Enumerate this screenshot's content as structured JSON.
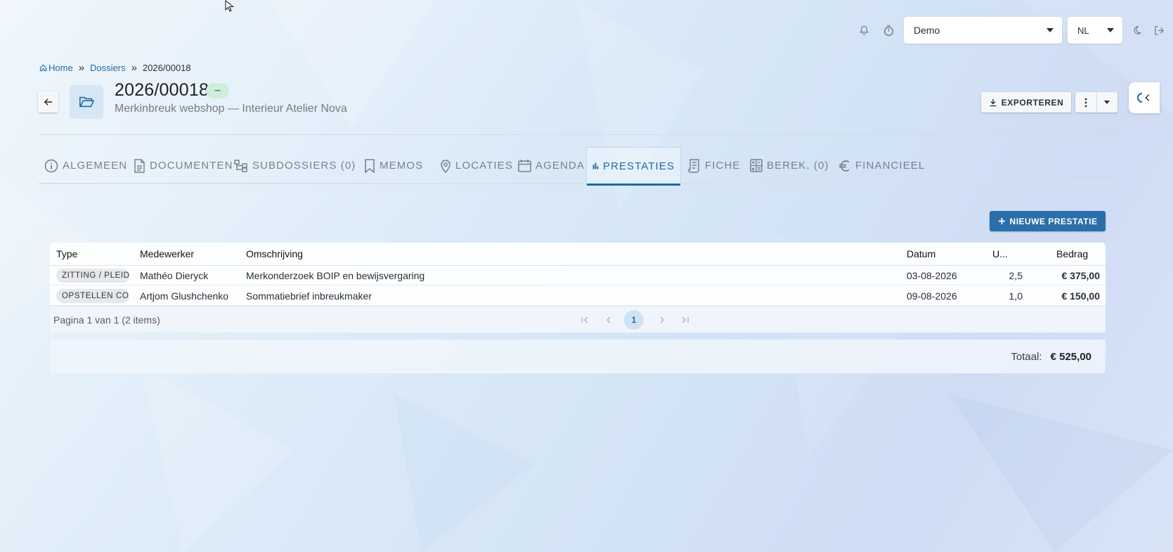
{
  "topbar": {
    "organisation": "Demo",
    "language": "NL"
  },
  "breadcrumb": {
    "home": "Home",
    "dossiers": "Dossiers",
    "current": "2026/00018"
  },
  "header": {
    "title": "2026/00018",
    "status": "–",
    "subtitle": "Merkinbreuk webshop — Interieur Atelier Nova",
    "export_label": "EXPORTEREN"
  },
  "tabs": [
    {
      "label": "ALGEMEEN",
      "icon": "info-icon"
    },
    {
      "label": "DOCUMENTEN",
      "icon": "document-icon"
    },
    {
      "label": "SUBDOSSIERS (0)",
      "icon": "tree-icon"
    },
    {
      "label": "MEMOS",
      "icon": "bookmark-icon"
    },
    {
      "label": "LOCATIES",
      "icon": "location-pin-icon"
    },
    {
      "label": "AGENDA",
      "icon": "calendar-icon"
    },
    {
      "label": "PRESTATIES",
      "icon": "bar-chart-icon",
      "active": true
    },
    {
      "label": "FICHE",
      "icon": "receipt-icon"
    },
    {
      "label": "BEREK. (0)",
      "icon": "calculator-icon"
    },
    {
      "label": "FINANCIEEL",
      "icon": "euro-icon"
    }
  ],
  "new_button": "NIEUWE PRESTATIE",
  "table": {
    "columns": [
      "Type",
      "Medewerker",
      "Omschrijving",
      "Datum",
      "U...",
      "Bedrag"
    ],
    "rows": [
      {
        "type": "ZITTING / PLEIDOOI",
        "employee": "Mathéo Dieryck",
        "description": "Merkonderzoek BOIP en bewijsvergaring",
        "date": "03-08-2026",
        "hours": "2,5",
        "amount": "€ 375,00"
      },
      {
        "type": "OPSTELLEN CONCLUSIE",
        "employee": "Artjom Glushchenko",
        "description": "Sommatiebrief inbreukmaker",
        "date": "09-08-2026",
        "hours": "1,0",
        "amount": "€ 150,00"
      }
    ]
  },
  "pager": {
    "text": "Pagina 1 van 1 (2 items)",
    "current_page": "1"
  },
  "totals": {
    "label": "Totaal:",
    "value": "€ 525,00"
  },
  "colors": {
    "accent": "#2a6fac",
    "link": "#1f6aa5",
    "status_bg": "#cfeed9",
    "status_fg": "#2e9e58"
  }
}
